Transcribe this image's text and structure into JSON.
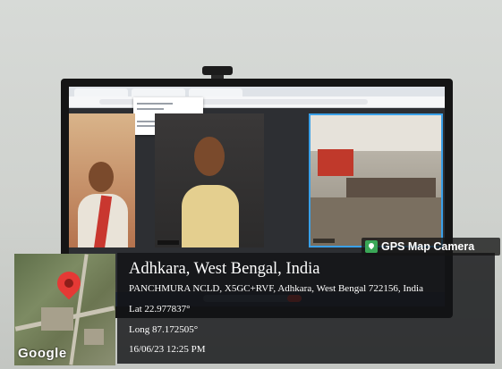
{
  "overlay": {
    "badge_title": "GPS Map Camera",
    "location": "Adhkara, West Bengal, India",
    "address": "PANCHMURA NCLD, X5GC+RVF, Adhkara, West Bengal 722156, India",
    "latitude": "Lat 22.977837°",
    "longitude": "Long 87.172505°",
    "datetime": "16/06/23 12:25 PM",
    "map_attribution": "Google",
    "badge_icon": "map-pin-icon",
    "pin_icon": "map-pin-icon",
    "pin_color": "#e53935"
  },
  "screen": {
    "app": "video-conference",
    "participant_tiles": 3,
    "active_tile_color": "#3aa0e8"
  }
}
